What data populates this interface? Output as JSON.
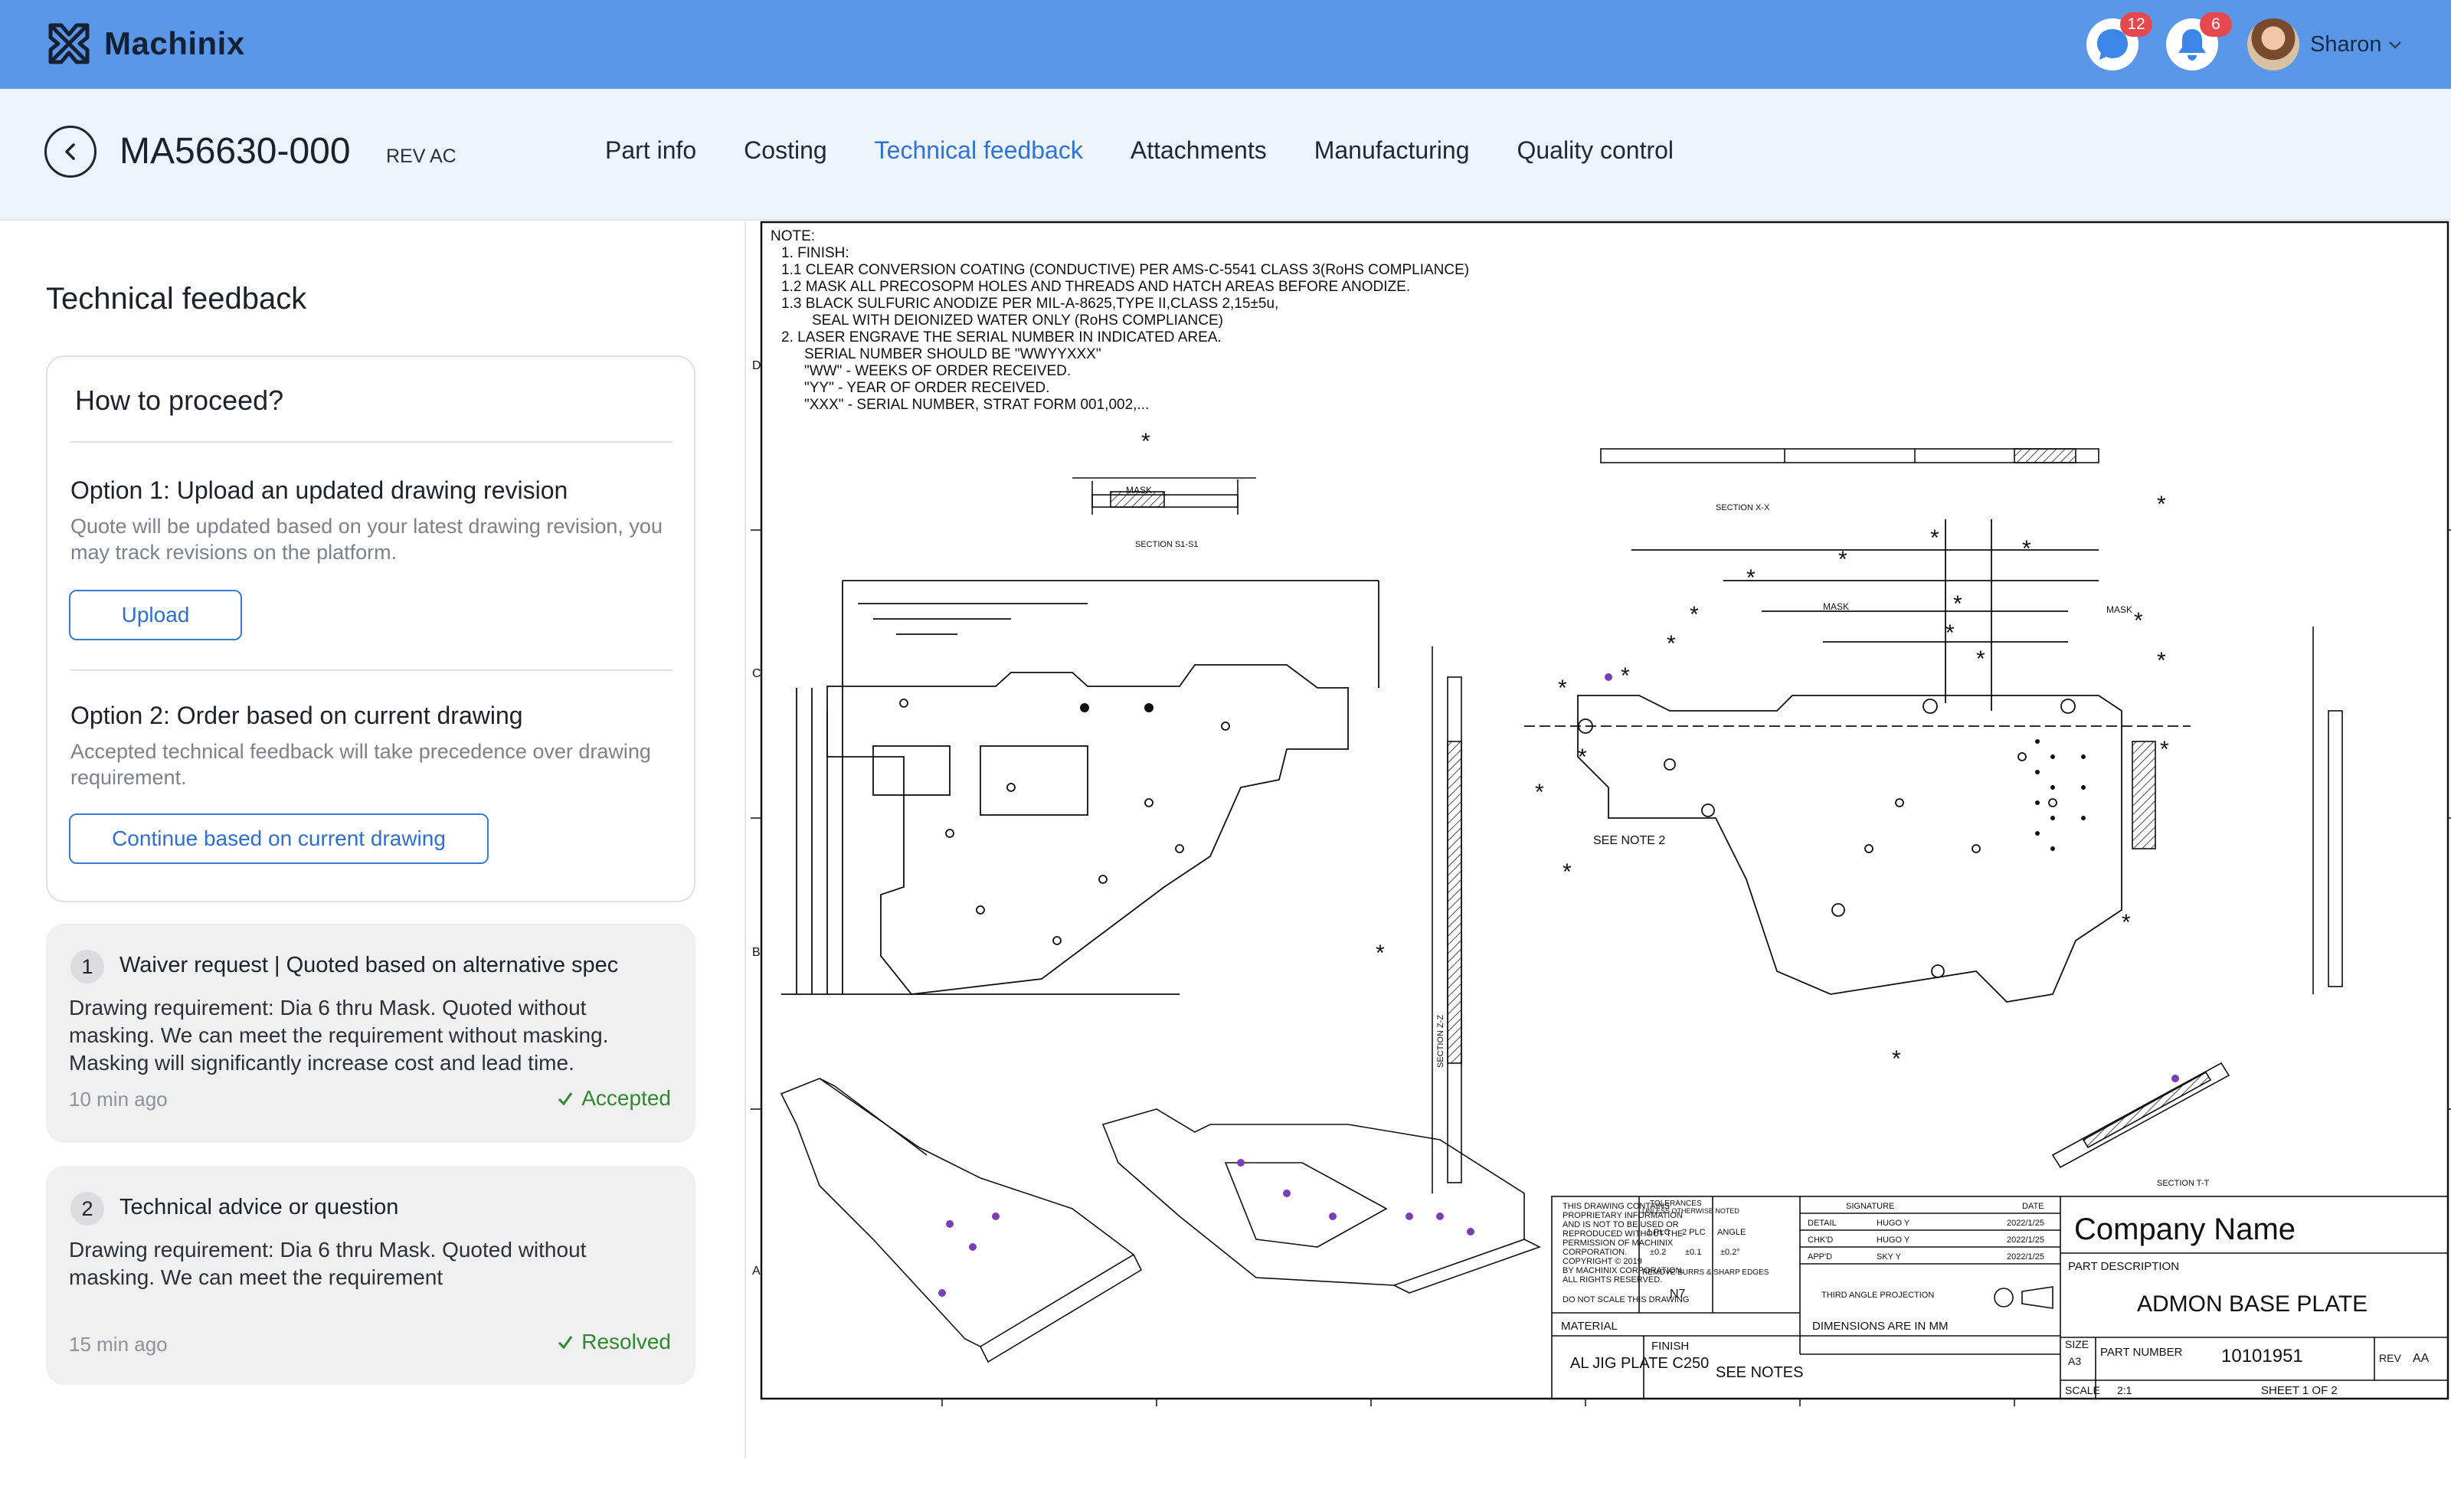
{
  "app": {
    "brand": "Machinix",
    "messages_badge": "12",
    "notifications_badge": "6",
    "user_name": "Sharon"
  },
  "part": {
    "number": "MA56630-000",
    "rev": "REV AC"
  },
  "nav": {
    "tabs": [
      "Part info",
      "Costing",
      "Technical feedback",
      "Attachments",
      "Manufacturing",
      "Quality control"
    ],
    "active": "Technical feedback"
  },
  "panel": {
    "title": "Technical feedback",
    "proceed": {
      "title": "How to proceed?",
      "option1_title": "Option 1: Upload an updated drawing revision",
      "option1_desc": "Quote will be updated based on your latest drawing revision, you may track revisions on the platform.",
      "upload_label": "Upload",
      "option2_title": "Option 2: Order based on current drawing",
      "option2_desc": "Accepted technical feedback will take precedence over drawing requirement.",
      "continue_label": "Continue based on current drawing"
    },
    "feedback": [
      {
        "num": "1",
        "title": "Waiver request | Quoted based on alternative spec",
        "body": "Drawing requirement: Dia 6 thru Mask. Quoted without masking. We can meet the requirement without masking. Masking will significantly increase cost and lead time.",
        "time": "10 min ago",
        "status": "Accepted"
      },
      {
        "num": "2",
        "title": "Technical advice or question",
        "body": "Drawing requirement: Dia 6 thru Mask. Quoted without masking. We can meet the requirement",
        "time": "15 min ago",
        "status": "Resolved"
      }
    ]
  },
  "drawing": {
    "notes": [
      "NOTE:",
      "1.  FINISH:",
      "1.1  CLEAR CONVERSION COATING (CONDUCTIVE) PER AMS-C-5541 CLASS 3(RoHS COMPLIANCE)",
      "1.2  MASK ALL PRECOSOPM HOLES AND THREADS AND HATCH AREAS BEFORE ANODIZE.",
      "1.3  BLACK SULFURIC ANODIZE PER MIL-A-8625,TYPE II,CLASS 2,15±5u,",
      "SEAL WITH DEIONIZED WATER ONLY (RoHS COMPLIANCE)",
      "2.  LASER ENGRAVE THE SERIAL NUMBER IN INDICATED AREA.",
      "SERIAL NUMBER SHOULD BE   \"WWYYXXX\"",
      "\"WW\"  - WEEKS OF ORDER RECEIVED.",
      "\"YY\"  - YEAR OF ORDER RECEIVED.",
      "\"XXX\"  - SERIAL NUMBER, STRAT FORM 001,002,..."
    ],
    "section_labels": [
      "SECTION  S1-S1",
      "SECTION  X-X",
      "SECTION  Z-Z",
      "SECTION  T-T"
    ],
    "see_note": "SEE NOTE 2",
    "mask": "MASK",
    "zones": [
      "D",
      "C",
      "B",
      "A"
    ],
    "title_block": {
      "company": "Company Name",
      "part_description_label": "PART DESCRIPTION",
      "part_description": "ADMON BASE PLATE",
      "material_label": "MATERIAL",
      "material": "AL JIG PLATE C250",
      "finish_label": "FINISH",
      "finish": "SEE NOTES",
      "dimensions": "DIMENSIONS ARE IN MM",
      "size_label": "SIZE",
      "size": "A3",
      "part_number_label": "PART NUMBER",
      "part_number": "10101951",
      "rev_label": "REV",
      "rev": "AA",
      "scale_label": "SCALE",
      "scale": "2:1",
      "sheet": "SHEET 1 OF 2",
      "proprietary": [
        "THIS DRAWING CONTAINS",
        "PROPRIETARY INFORMATION",
        "AND IS NOT TO BE USED OR",
        "REPRODUCED WITHOUT THE",
        "PERMISSION OF MACHINIX",
        "CORPORATION.",
        "COPYRIGHT © 2019",
        "BY MACHINIX CORPORATION.",
        "ALL RIGHTS RESERVED."
      ],
      "do_not_scale": "DO NOT SCALE THIS DRAWING",
      "tolerances": "TOLERANCES",
      "unless_noted": "UNLESS OTHERWISE NOTED",
      "tol_heads": [
        "1 PLC",
        "2 PLC",
        "ANGLE"
      ],
      "tol_vals": [
        "±0.2",
        "±0.1",
        "±0.2°"
      ],
      "burrs": "REMOVE BURRS & SHARP EDGES",
      "surface": "N7",
      "signature": "SIGNATURE",
      "date": "DATE",
      "sign_rows": [
        {
          "role": "DETAIL",
          "name": "HUGO Y",
          "date": "2022/1/25"
        },
        {
          "role": "CHK'D",
          "name": "HUGO Y",
          "date": "2022/1/25"
        },
        {
          "role": "APP'D",
          "name": "SKY Y",
          "date": "2022/1/25"
        }
      ],
      "projection": "THIRD ANGLE PROJECTION"
    }
  }
}
